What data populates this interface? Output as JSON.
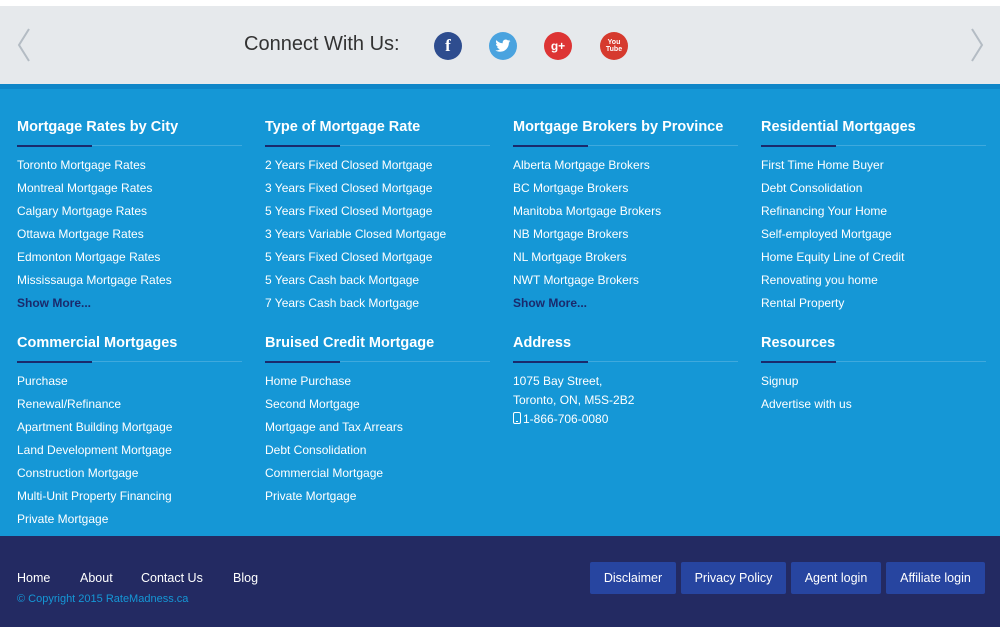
{
  "connect": {
    "title": "Connect With Us:",
    "social": [
      {
        "name": "facebook-icon",
        "glyph": "f"
      },
      {
        "name": "twitter-icon",
        "glyph": ""
      },
      {
        "name": "google-plus-icon",
        "glyph": "g+"
      },
      {
        "name": "youtube-icon",
        "glyph_top": "You",
        "glyph_bottom": "Tube"
      }
    ]
  },
  "columns": {
    "rates_by_city": {
      "title": "Mortgage Rates by City",
      "items": [
        "Toronto Mortgage Rates",
        "Montreal Mortgage Rates",
        "Calgary Mortgage Rates",
        "Ottawa Mortgage Rates",
        "Edmonton Mortgage Rates",
        "Mississauga Mortgage Rates"
      ],
      "more": "Show More..."
    },
    "rate_type": {
      "title": "Type of Mortgage Rate",
      "items": [
        "2 Years Fixed Closed Mortgage",
        "3 Years Fixed Closed Mortgage",
        "5 Years Fixed Closed Mortgage",
        "3 Years Variable Closed Mortgage",
        "5 Years Fixed Closed Mortgage",
        "5 Years Cash back Mortgage",
        "7 Years Cash back Mortgage"
      ]
    },
    "brokers": {
      "title": "Mortgage Brokers by Province",
      "items": [
        "Alberta Mortgage Brokers",
        "BC Mortgage Brokers",
        "Manitoba Mortgage Brokers",
        "NB Mortgage Brokers",
        "NL Mortgage Brokers",
        "NWT Mortgage Brokers"
      ],
      "more": "Show More..."
    },
    "residential": {
      "title": "Residential Mortgages",
      "items": [
        "First Time Home Buyer",
        "Debt Consolidation",
        "Refinancing Your Home",
        "Self-employed Mortgage",
        "Home Equity Line of Credit",
        "Renovating you home",
        "Rental Property"
      ]
    },
    "commercial": {
      "title": "Commercial Mortgages",
      "items": [
        "Purchase",
        "Renewal/Refinance",
        "Apartment Building Mortgage",
        "Land Development Mortgage",
        "Construction Mortgage",
        "Multi-Unit Property Financing",
        "Private Mortgage"
      ]
    },
    "bruised": {
      "title": "Bruised Credit Mortgage",
      "items": [
        "Home Purchase",
        "Second Mortgage",
        "Mortgage and Tax Arrears",
        "Debt Consolidation",
        "Commercial Mortgage",
        "Private Mortgage"
      ]
    },
    "address": {
      "title": "Address",
      "street": "1075 Bay Street,",
      "city": "Toronto, ON, M5S-2B2",
      "phone": "1-866-706-0080"
    },
    "resources": {
      "title": "Resources",
      "items": [
        "Signup",
        "Advertise with us"
      ]
    }
  },
  "footer": {
    "nav": [
      "Home",
      "About",
      "Contact Us",
      "Blog"
    ],
    "copyright": "© Copyright 2015 RateMadness.ca",
    "buttons": [
      "Disclaimer",
      "Privacy Policy",
      "Agent login",
      "Affiliate login"
    ]
  },
  "colors": {
    "footer_blue": "#1597d6",
    "footer_dark": "#232a62",
    "button_blue": "#2745a0",
    "connect_bg": "#e6e9ec"
  }
}
